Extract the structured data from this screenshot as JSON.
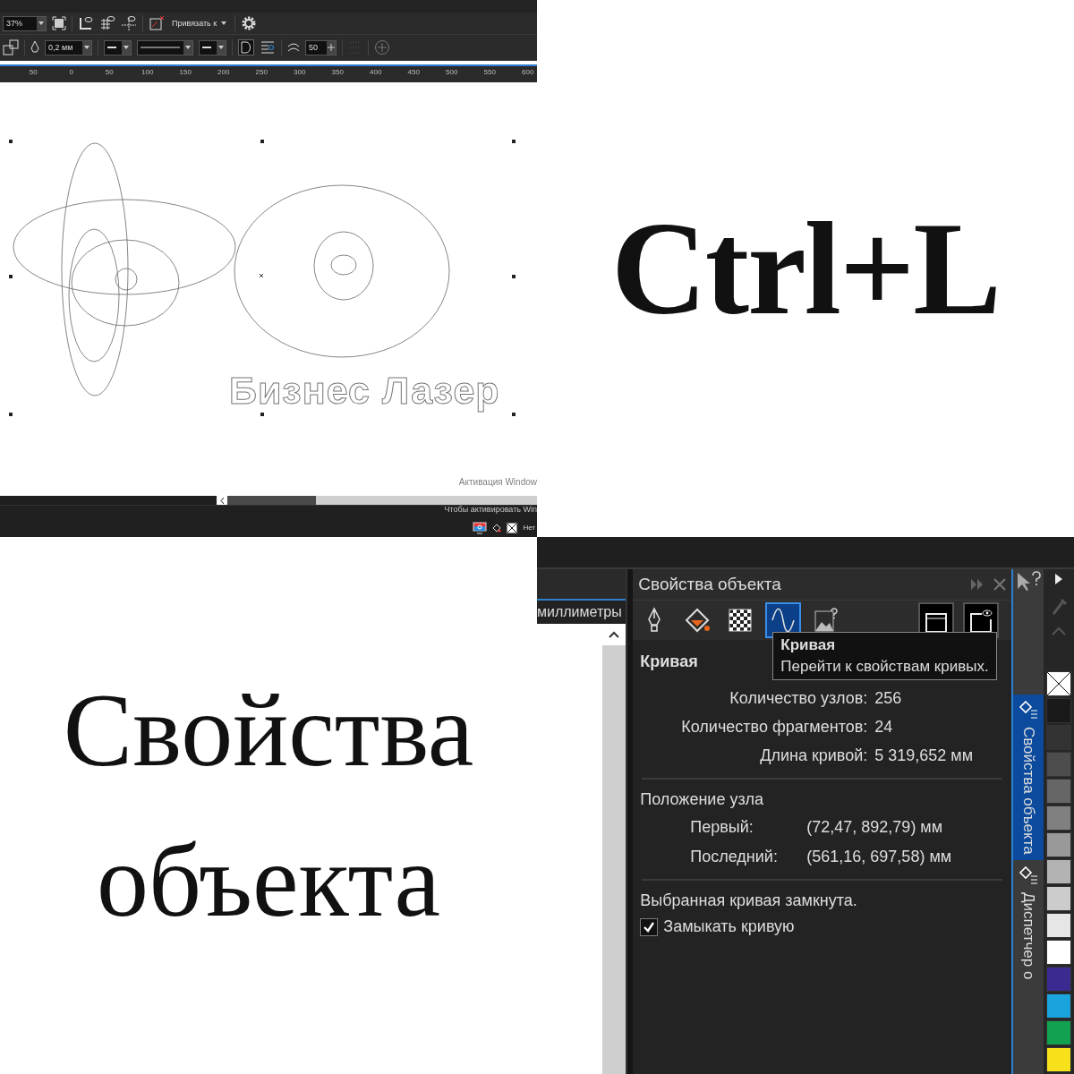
{
  "editor": {
    "toolbar_1": {
      "zoom": "37%",
      "snap_label": "Привязать к"
    },
    "toolbar_2": {
      "outline_width": "0,2 мм",
      "smoothing": "50"
    },
    "ruler": {
      "labels": [
        "50",
        "0",
        "50",
        "100",
        "150",
        "200",
        "250",
        "300",
        "350",
        "400",
        "450",
        "500",
        "550",
        "600"
      ]
    },
    "canvas": {
      "outlined_text": "Бизнес Лазер"
    },
    "os_notice": [
      "Активация Window",
      "Чтобы активировать Win"
    ],
    "status_bar": {
      "fill": "Нет"
    }
  },
  "caption_shortcut": "Ctrl+L",
  "caption_title": [
    "Свойства",
    "объекта"
  ],
  "units_tab": "миллиметры",
  "panel": {
    "title": "Свойства объекта",
    "tabs": [
      {
        "kind": "pen",
        "selected": false
      },
      {
        "kind": "fill",
        "selected": false
      },
      {
        "kind": "transparency",
        "selected": false
      },
      {
        "kind": "curve",
        "selected": true
      },
      {
        "kind": "image",
        "selected": false
      },
      {
        "kind": "frame",
        "selected": false
      },
      {
        "kind": "summary",
        "selected": false
      }
    ],
    "tooltip": {
      "title": "Кривая",
      "text": "Перейти к свойствам кривых."
    },
    "section": "Кривая",
    "stats": [
      {
        "label": "Количество узлов:",
        "value": "256"
      },
      {
        "label": "Количество фрагментов:",
        "value": "24"
      },
      {
        "label": "Длина кривой:",
        "value": "5 319,652 мм"
      }
    ],
    "node_heading": "Положение узла",
    "nodes": [
      {
        "label": "Первый:",
        "value": "(72,47, 892,79) мм"
      },
      {
        "label": "Последний:",
        "value": "(561,16, 697,58) мм"
      }
    ],
    "closed_note": "Выбранная кривая замкнута.",
    "close_curve": {
      "label": "Замыкать кривую",
      "checked": true
    }
  },
  "side_tabs": [
    {
      "label": "Свойства объекта",
      "selected": true
    },
    {
      "label": "Диспетчер о",
      "selected": false
    }
  ],
  "palette": [
    {
      "kind": "none"
    },
    {
      "kind": "swatch",
      "color": "#1a1a1a"
    },
    {
      "kind": "swatch",
      "color": "#333333"
    },
    {
      "kind": "swatch",
      "color": "#4d4d4d"
    },
    {
      "kind": "swatch",
      "color": "#666666"
    },
    {
      "kind": "swatch",
      "color": "#808080"
    },
    {
      "kind": "swatch",
      "color": "#999999"
    },
    {
      "kind": "swatch",
      "color": "#b3b3b3"
    },
    {
      "kind": "swatch",
      "color": "#cccccc"
    },
    {
      "kind": "swatch",
      "color": "#e6e6e6"
    },
    {
      "kind": "swatch",
      "color": "#ffffff"
    },
    {
      "kind": "swatch",
      "color": "#3b2a8f"
    },
    {
      "kind": "swatch",
      "color": "#1aa3dc"
    },
    {
      "kind": "swatch",
      "color": "#12a150"
    },
    {
      "kind": "swatch",
      "color": "#f7e11b"
    }
  ]
}
